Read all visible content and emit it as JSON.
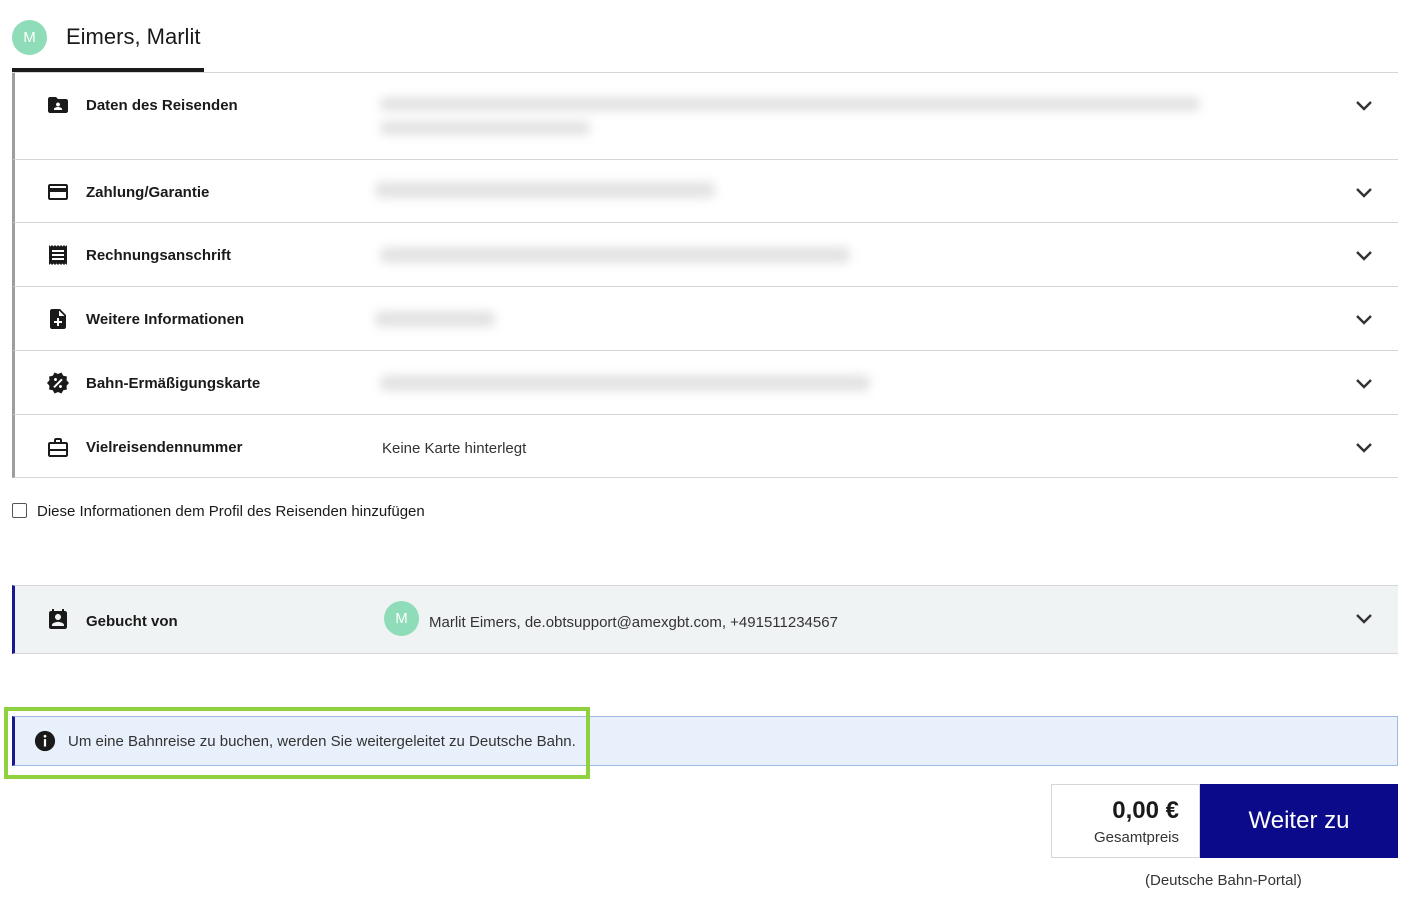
{
  "traveler": {
    "avatar_initial": "M",
    "name": "Eimers, Marlit"
  },
  "sections": [
    {
      "label": "Daten des Reisenden",
      "icon": "person-folder-icon",
      "value": ""
    },
    {
      "label": "Zahlung/Garantie",
      "icon": "credit-card-icon",
      "value": ""
    },
    {
      "label": "Rechnungsanschrift",
      "icon": "receipt-icon",
      "value": ""
    },
    {
      "label": "Weitere Informationen",
      "icon": "note-add-icon",
      "value": ""
    },
    {
      "label": "Bahn-Ermäßigungskarte",
      "icon": "discount-badge-icon",
      "value": ""
    },
    {
      "label": "Vielreisendennummer",
      "icon": "briefcase-icon",
      "value": "Keine Karte hinterlegt"
    }
  ],
  "save_to_profile": {
    "label": "Diese Informationen dem Profil des Reisenden hinzufügen",
    "checked": false
  },
  "booked_by": {
    "label": "Gebucht von",
    "icon": "calendar-person-icon",
    "avatar_initial": "M",
    "value": "Marlit Eimers, de.obtsupport@amexgbt.com, +491511234567"
  },
  "info_banner": {
    "text": "Um eine Bahnreise zu buchen, werden Sie weitergeleitet zu Deutsche Bahn."
  },
  "price": {
    "amount": "0,00 €",
    "caption": "Gesamtpreis"
  },
  "cta": {
    "label": "Weiter zu",
    "note": "(Deutsche Bahn-Portal)"
  },
  "colors": {
    "accent": "#0b0a8a",
    "avatar": "#8fdcb8",
    "highlight": "#8fd13f",
    "info_bg": "#e8f0fb"
  }
}
